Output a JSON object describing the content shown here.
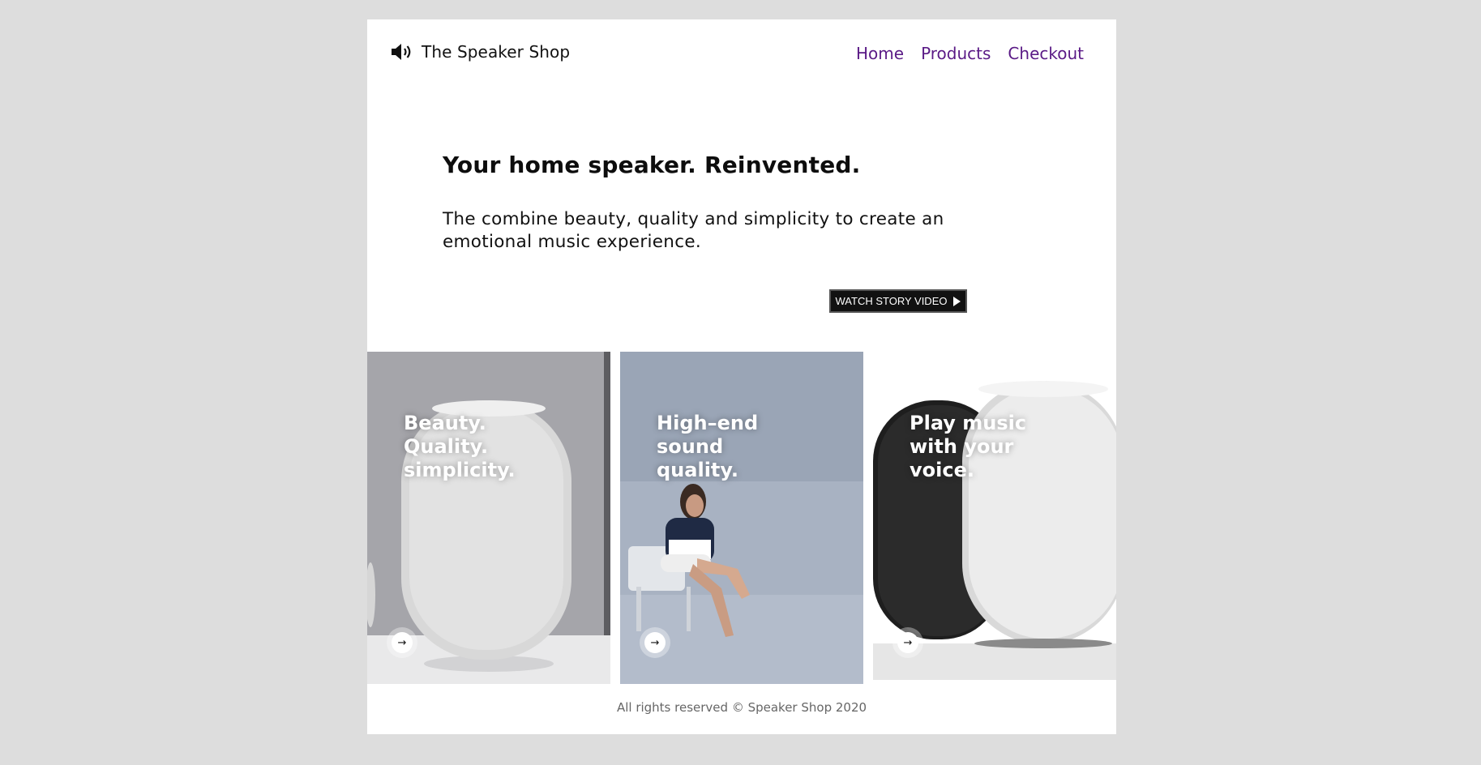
{
  "header": {
    "brand": "The Speaker Shop",
    "brand_icon": "speaker-volume-icon",
    "nav": [
      "Home",
      "Products",
      "Checkout"
    ]
  },
  "hero": {
    "title": "Your home speaker. Reinvented.",
    "subtitle": "The combine beauty, quality and simplicity to create an emotional music experience.",
    "cta_label": "WATCH STORY VIDEO",
    "cta_icon": "play-icon"
  },
  "cards": [
    {
      "title": "Beauty. Quality. simplicity.",
      "lines": [
        "Beauty.",
        "Quality.",
        "simplicity."
      ],
      "arrow_icon": "arrow-right-icon"
    },
    {
      "title": "High-end sound quality.",
      "lines": [
        "High–end",
        "sound",
        "quality."
      ],
      "arrow_icon": "arrow-right-icon"
    },
    {
      "title": "Play music with your voice.",
      "lines": [
        "Play music",
        "with your",
        "voice."
      ],
      "arrow_icon": "arrow-right-icon"
    }
  ],
  "footer": {
    "text": "All rights reserved © Speaker Shop 2020"
  },
  "colors": {
    "nav_link": "#5a1a86",
    "background": "#dddddd",
    "button": "#111111"
  }
}
